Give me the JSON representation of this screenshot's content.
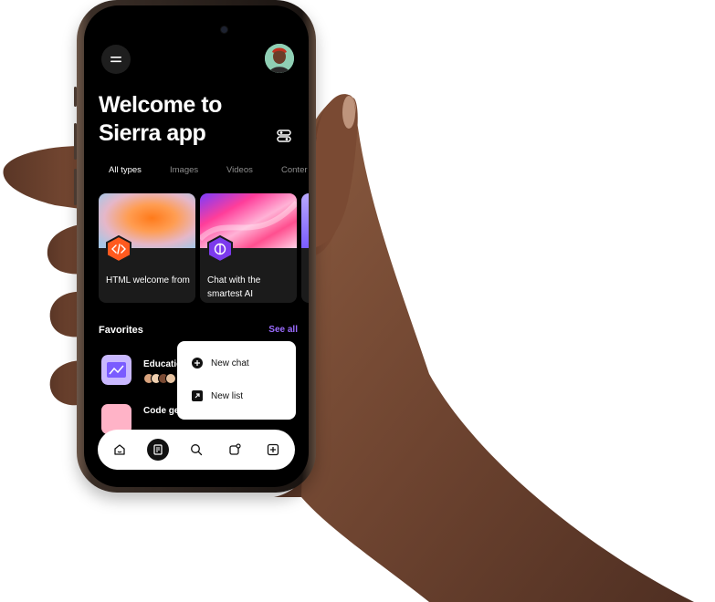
{
  "app": {
    "title": "Welcome to Sierra app",
    "filter_icon": "sliders-icon",
    "menu_icon": "menu-icon"
  },
  "tabs": [
    {
      "label": "All types",
      "active": true
    },
    {
      "label": "Images",
      "active": false
    },
    {
      "label": "Videos",
      "active": false
    },
    {
      "label": "Conter",
      "active": false
    }
  ],
  "cards": [
    {
      "label": "HTML welcome from",
      "icon": "code-icon",
      "accent": "#ff5a1f"
    },
    {
      "label": "Chat with the smartest AI",
      "icon": "ai-icon",
      "accent": "#7c3aed"
    }
  ],
  "favorites": {
    "heading": "Favorites",
    "see_all": "See all",
    "items": [
      {
        "title": "Educatio"
      },
      {
        "title": "Code ge"
      }
    ]
  },
  "popup": {
    "new_chat": "New chat",
    "new_list": "New list"
  },
  "tabbar": [
    {
      "icon": "home-icon",
      "active": false
    },
    {
      "icon": "document-icon",
      "active": true
    },
    {
      "icon": "search-icon",
      "active": false
    },
    {
      "icon": "notification-icon",
      "active": false
    },
    {
      "icon": "add-icon",
      "active": false
    }
  ],
  "colors": {
    "accent": "#9b6bff",
    "screen_bg": "#000000",
    "card_bg": "#1b1b1b"
  }
}
